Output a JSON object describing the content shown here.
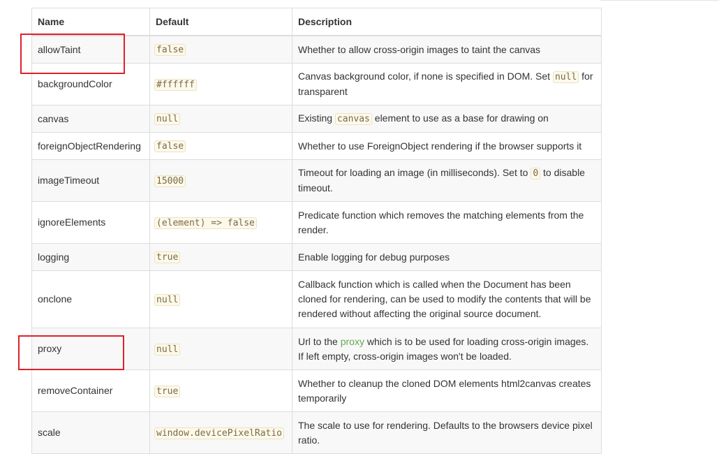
{
  "table": {
    "headers": {
      "name": "Name",
      "default": "Default",
      "description": "Description"
    },
    "rows": [
      {
        "name": "allowTaint",
        "default": "false",
        "description": [
          {
            "t": "text",
            "v": "Whether to allow cross-origin images to taint the canvas"
          }
        ]
      },
      {
        "name": "backgroundColor",
        "default": "#ffffff",
        "description": [
          {
            "t": "text",
            "v": "Canvas background color, if none is specified in DOM. Set "
          },
          {
            "t": "code",
            "v": "null"
          },
          {
            "t": "text",
            "v": " for transparent"
          }
        ]
      },
      {
        "name": "canvas",
        "default": "null",
        "description": [
          {
            "t": "text",
            "v": "Existing "
          },
          {
            "t": "code",
            "v": "canvas"
          },
          {
            "t": "text",
            "v": " element to use as a base for drawing on"
          }
        ]
      },
      {
        "name": "foreignObjectRendering",
        "default": "false",
        "description": [
          {
            "t": "text",
            "v": "Whether to use ForeignObject rendering if the browser supports it"
          }
        ]
      },
      {
        "name": "imageTimeout",
        "default": "15000",
        "description": [
          {
            "t": "text",
            "v": "Timeout for loading an image (in milliseconds). Set to "
          },
          {
            "t": "code",
            "v": "0"
          },
          {
            "t": "text",
            "v": " to disable timeout."
          }
        ]
      },
      {
        "name": "ignoreElements",
        "default": "(element) => false",
        "description": [
          {
            "t": "text",
            "v": "Predicate function which removes the matching elements from the render."
          }
        ]
      },
      {
        "name": "logging",
        "default": "true",
        "description": [
          {
            "t": "text",
            "v": "Enable logging for debug purposes"
          }
        ]
      },
      {
        "name": "onclone",
        "default": "null",
        "description": [
          {
            "t": "text",
            "v": "Callback function which is called when the Document has been cloned for rendering, can be used to modify the contents that will be rendered without affecting the original source document."
          }
        ]
      },
      {
        "name": "proxy",
        "default": "null",
        "description": [
          {
            "t": "text",
            "v": "Url to the "
          },
          {
            "t": "link",
            "v": "proxy"
          },
          {
            "t": "text",
            "v": " which is to be used for loading cross-origin images. If left empty, cross-origin images won't be loaded."
          }
        ]
      },
      {
        "name": "removeContainer",
        "default": "true",
        "description": [
          {
            "t": "text",
            "v": "Whether to cleanup the cloned DOM elements html2canvas creates temporarily"
          }
        ]
      },
      {
        "name": "scale",
        "default": "window.devicePixelRatio",
        "description": [
          {
            "t": "text",
            "v": "The scale to use for rendering. Defaults to the browsers device pixel ratio."
          }
        ]
      }
    ]
  },
  "colors": {
    "link": "#6aa84f",
    "highlight_border": "#e0202a",
    "code_background": "#fdf9ea",
    "stripe_background": "#f8f8f8"
  }
}
